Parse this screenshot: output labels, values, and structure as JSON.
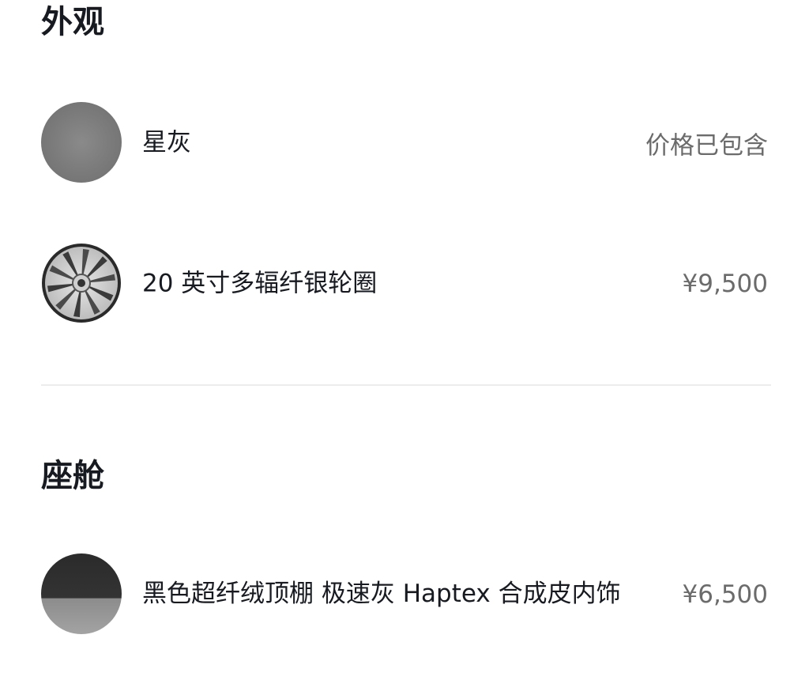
{
  "sections": {
    "exterior": {
      "title": "外观",
      "items": [
        {
          "name": "星灰",
          "price": "价格已包含",
          "swatch_color": "#7c7c7c",
          "icon": "paint-swatch-icon"
        },
        {
          "name": "20 英寸多辐纤银轮圈",
          "price": "¥9,500",
          "icon": "wheel-icon"
        }
      ]
    },
    "cabin": {
      "title": "座舱",
      "items": [
        {
          "name": "黑色超纤绒顶棚 极速灰 Haptex 合成皮内饰",
          "price": "¥6,500",
          "icon": "interior-swatch-icon"
        }
      ]
    }
  },
  "colors": {
    "title_text": "#171a20",
    "price_text": "#6b6b6b",
    "divider": "#ececec",
    "background": "#ffffff"
  }
}
